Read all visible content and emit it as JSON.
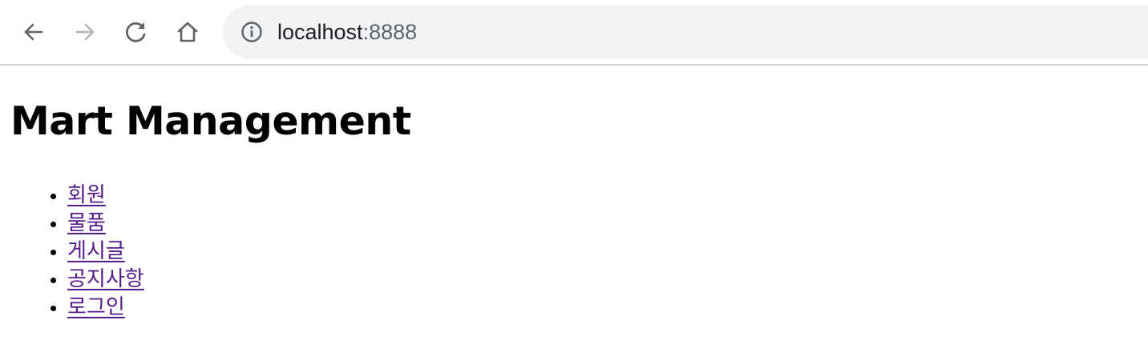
{
  "browser": {
    "url_host": "localhost",
    "url_port": ":8888",
    "icons": {
      "back": "arrow-left-icon",
      "forward": "arrow-right-icon",
      "reload": "reload-icon",
      "home": "home-icon",
      "site_info": "info-icon"
    },
    "colors": {
      "toolbar_bg": "#ffffff",
      "omnibox_bg": "#f1f3f4",
      "icon_active": "#5f6368",
      "icon_disabled": "#b0b3b8"
    }
  },
  "page": {
    "title": "Mart Management",
    "menu": [
      {
        "label": "회원"
      },
      {
        "label": "물품"
      },
      {
        "label": "게시글"
      },
      {
        "label": "공지사항"
      },
      {
        "label": "로그인"
      }
    ],
    "colors": {
      "visited_link": "#551a8b",
      "text": "#000000"
    }
  }
}
